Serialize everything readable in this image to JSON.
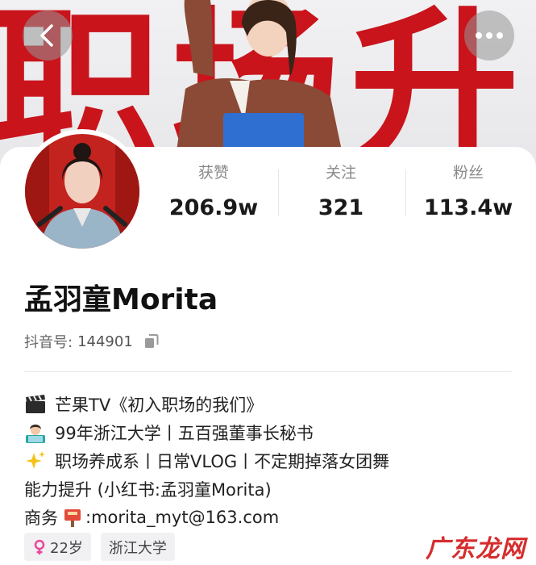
{
  "banner": {
    "text": "职场升"
  },
  "stats": [
    {
      "label": "获赞",
      "value": "206.9w"
    },
    {
      "label": "关注",
      "value": "321"
    },
    {
      "label": "粉丝",
      "value": "113.4w"
    }
  ],
  "profile": {
    "name": "孟羽童Morita",
    "id_label": "抖音号:",
    "id_value": "144901"
  },
  "bio": {
    "line1": "芒果TV《初入职场的我们》",
    "line2": "99年浙江大学丨五百强董事长秘书",
    "line3": "职场养成系丨日常VLOG丨不定期掉落女团舞",
    "line4": "能力提升 (小红书:孟羽童Morita)",
    "line5_prefix": "商务",
    "line5_suffix": ":morita_myt@163.com"
  },
  "tags": {
    "age": "22岁",
    "school": "浙江大学"
  },
  "watermark": "广东龙网",
  "colors": {
    "brand_red": "#c9141c",
    "gender_pink": "#e8479c"
  },
  "icons": [
    "back-arrow-icon",
    "more-dots-icon",
    "copy-icon",
    "clapperboard-icon",
    "student-icon",
    "sparkles-icon",
    "mailbox-icon",
    "female-icon"
  ]
}
